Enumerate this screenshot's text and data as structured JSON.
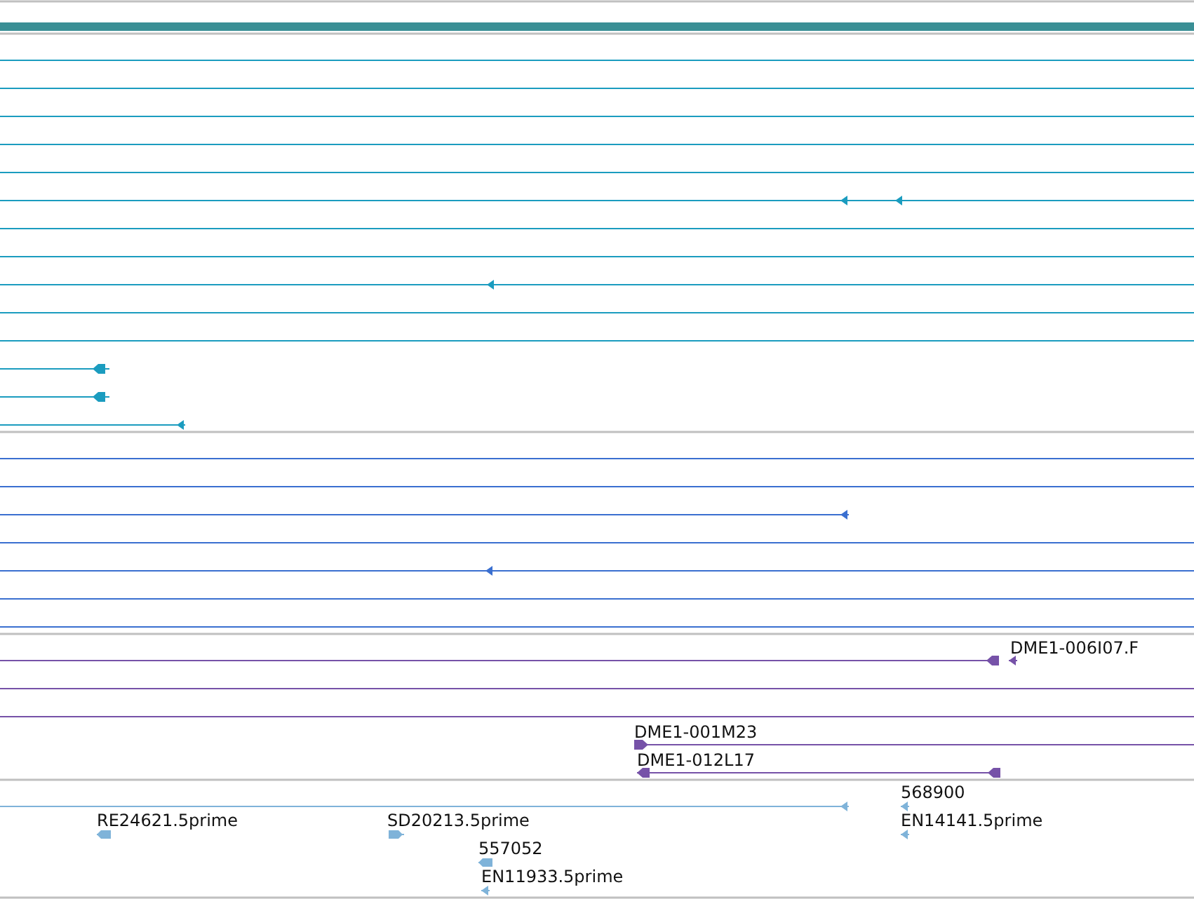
{
  "tracks": [
    {
      "color": "#1b9cbf"
    },
    {
      "color": "#3a6fd0"
    },
    {
      "color": "#7652a8",
      "labels": [
        "DME1-006I07.F",
        "DME1-001M23",
        "DME1-012L17"
      ]
    },
    {
      "color": "#7fb3d9",
      "labels": [
        "568900",
        "RE24621.5prime",
        "SD20213.5prime",
        "EN14141.5prime",
        "557052",
        "EN11933.5prime"
      ]
    }
  ]
}
